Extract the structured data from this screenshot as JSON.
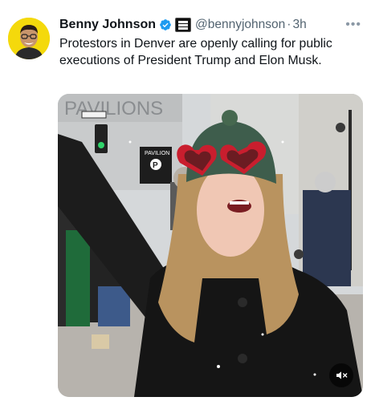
{
  "author": {
    "name": "Benny Johnson",
    "handle": "@bennyjohnson",
    "time": "3h",
    "separator": "·"
  },
  "tweet": {
    "text": "Protestors in Denver are openly calling for public executions of President Trump and Elon Musk."
  },
  "media": {
    "type": "video",
    "sign_text": "PAVILIONS",
    "parking_sign": "PAVILION",
    "parking_letter": "P"
  },
  "colors": {
    "verified": "#1d9bf0",
    "avatar_bg": "#f4d90c",
    "muted_text": "#536471"
  },
  "icons": {
    "verified": "verified-badge-icon",
    "affiliation": "affiliation-badge-icon",
    "more": "more-options-icon",
    "mute": "speaker-muted-icon"
  }
}
